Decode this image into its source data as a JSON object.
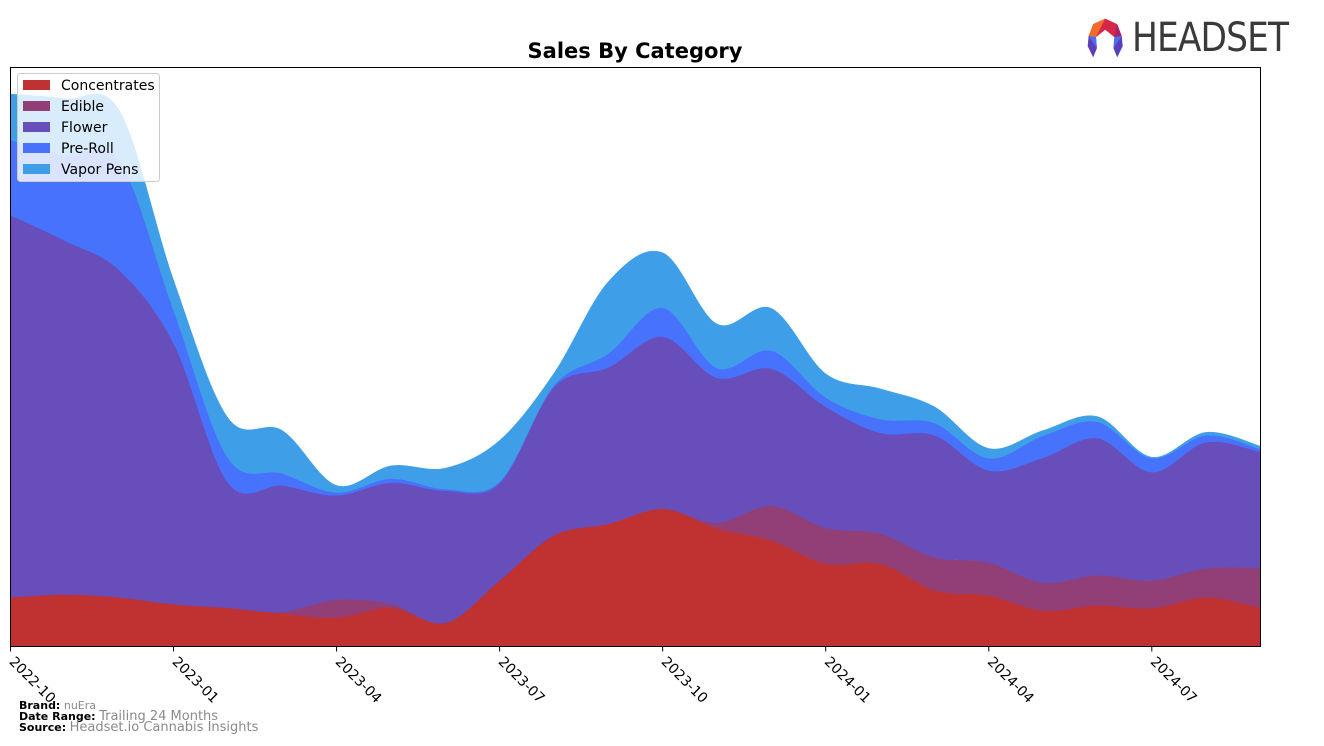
{
  "logo": {
    "text": "HEADSET",
    "icon": "headset-logo-icon"
  },
  "footer": {
    "brand_label": "Brand:",
    "brand_value": "nuEra",
    "date_range_label": "Date Range:",
    "date_range_value": "Trailing 24 Months",
    "source_label": "Source:",
    "source_value": "Headset.io Cannabis Insights"
  },
  "chart_data": {
    "type": "area",
    "stacked": true,
    "title": "Sales By Category",
    "xlabel": "",
    "ylabel": "",
    "y_ticks_visible": false,
    "ylim": [
      0,
      100
    ],
    "grid": false,
    "legend_position": "top-left",
    "x": [
      "2022-10",
      "2022-11",
      "2022-12",
      "2023-01",
      "2023-02",
      "2023-03",
      "2023-04",
      "2023-05",
      "2023-06",
      "2023-07",
      "2023-08",
      "2023-09",
      "2023-10",
      "2023-11",
      "2023-12",
      "2024-01",
      "2024-02",
      "2024-03",
      "2024-04",
      "2024-05",
      "2024-06",
      "2024-07",
      "2024-08",
      "2024-09"
    ],
    "x_tick_labels": [
      "2022-10",
      "2023-01",
      "2023-04",
      "2023-07",
      "2023-10",
      "2024-01",
      "2024-04",
      "2024-07"
    ],
    "series": [
      {
        "name": "Concentrates",
        "color": "#c03232",
        "values": [
          8.5,
          9.0,
          8.5,
          7.3,
          6.7,
          5.7,
          5.0,
          6.7,
          4.1,
          11.4,
          19.2,
          21.2,
          23.8,
          20.4,
          18.3,
          14.3,
          14.3,
          9.7,
          8.8,
          6.2,
          7.1,
          6.6,
          8.5,
          6.7
        ]
      },
      {
        "name": "Edible",
        "color": "#923e77",
        "values": [
          0,
          0,
          0,
          0,
          0,
          0.3,
          3.1,
          0.7,
          0,
          0,
          0,
          0,
          0,
          1.0,
          6.0,
          6.2,
          5.2,
          5.7,
          5.7,
          4.8,
          5.2,
          4.8,
          5.0,
          6.9
        ]
      },
      {
        "name": "Flower",
        "color": "#674ebb",
        "values": [
          66.0,
          61.1,
          56.5,
          45.1,
          21.6,
          21.8,
          18.0,
          20.9,
          22.8,
          16.8,
          25.6,
          27.0,
          29.7,
          25.0,
          23.7,
          20.9,
          17.4,
          21.1,
          15.9,
          21.6,
          23.7,
          18.7,
          21.8,
          20.0
        ]
      },
      {
        "name": "Pre-Roll",
        "color": "#4672fc",
        "values": [
          13.0,
          14.7,
          19.0,
          5.7,
          4.3,
          2.1,
          0.5,
          0.7,
          0.3,
          0.3,
          0.3,
          2.4,
          5.0,
          1.7,
          3.1,
          1.6,
          2.4,
          2.1,
          2.1,
          3.8,
          2.8,
          2.4,
          1.2,
          0.5
        ]
      },
      {
        "name": "Vapor Pens",
        "color": "#3e9fe8",
        "values": [
          7.9,
          9.8,
          8.6,
          5.2,
          6.9,
          7.4,
          1.2,
          2.2,
          3.6,
          7.1,
          2.1,
          12.4,
          9.5,
          7.6,
          7.3,
          4.1,
          5.2,
          2.8,
          1.7,
          0.9,
          0.9,
          0.2,
          0.5,
          0.5
        ]
      }
    ]
  }
}
